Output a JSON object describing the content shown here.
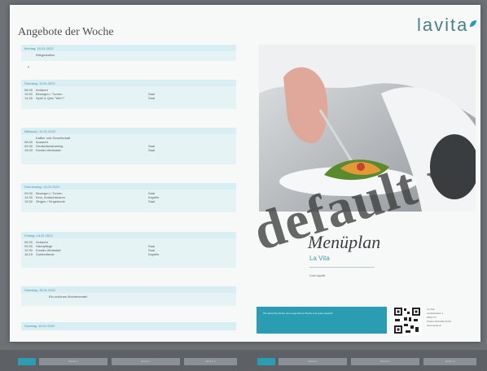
{
  "header": {
    "title": "Angebote der Woche",
    "logo_text": "lavita"
  },
  "days": [
    {
      "head": "Montag, 10.01.2022",
      "rows": [
        {
          "t": "",
          "d": "Wiegestation",
          "r": ""
        }
      ],
      "note": ""
    },
    {
      "head": "Dienstag, 11.01.2022",
      "rows": [
        {
          "t": "08:30",
          "d": "Andacht",
          "r": ""
        },
        {
          "t": "10:00",
          "d": "Bewegen / Turnen",
          "r": "Saal"
        },
        {
          "t": "14:30",
          "d": "Spiel & Quiz \"Wer?\"",
          "r": "Saal"
        }
      ],
      "note": ""
    },
    {
      "head": "Mittwoch, 12.01.2022",
      "rows": [
        {
          "t": "",
          "d": "Kaffee und Gesellschaft",
          "r": ""
        },
        {
          "t": "08:30",
          "d": "Andacht",
          "r": ""
        },
        {
          "t": "09:30",
          "d": "Gedächtnistraining",
          "r": "Saal"
        },
        {
          "t": "15:00",
          "d": "Kreativ-Werkstatt",
          "r": "Saal"
        }
      ],
      "note": ""
    },
    {
      "head": "Donnerstag, 13.01.2022",
      "rows": [
        {
          "t": "09:30",
          "d": "Bewegen / Turnen",
          "r": "Saal"
        },
        {
          "t": "14:30",
          "d": "Kino, Andachtsraum",
          "r": "Kapelle"
        },
        {
          "t": "15:30",
          "d": "Singen / Singstunde",
          "r": "Saal"
        }
      ],
      "note": ""
    },
    {
      "head": "Freitag, 14.01.2022",
      "rows": [
        {
          "t": "08:30",
          "d": "Andacht",
          "r": ""
        },
        {
          "t": "09:30",
          "d": "Handpflege",
          "r": "Saal"
        },
        {
          "t": "10:30",
          "d": "Kreativ-Werkstatt",
          "r": "Saal"
        },
        {
          "t": "16:15",
          "d": "Gottesdienst",
          "r": "Kapelle"
        }
      ],
      "note": ""
    },
    {
      "head": "Samstag, 15.01.2022",
      "rows": [],
      "note": "Ein schönes Wochenende!"
    },
    {
      "head": "Sonntag, 16.01.2022",
      "rows": [],
      "note": ""
    }
  ],
  "menu": {
    "title": "Menüplan",
    "subtitle": "La Vita",
    "small": "Gute Appetit"
  },
  "teal_box": {
    "text": "Wir wünschen Ihnen eine angenehme Woche und guten Appetit!"
  },
  "contact": {
    "lines": [
      "La Vita",
      "Lavitastrasse 1",
      "0000 Ort",
      "Telefon 000 000 00 00",
      "www.lavita.ch"
    ]
  },
  "watermark": "default w",
  "tabs": [
    {
      "label": "",
      "active": true
    },
    {
      "label": "Woche 1",
      "active": false
    },
    {
      "label": "Woche 2",
      "active": false
    },
    {
      "label": "Woche 3",
      "active": false
    },
    {
      "label": "",
      "active": true
    },
    {
      "label": "Woche 1",
      "active": false
    },
    {
      "label": "Woche 2",
      "active": false
    },
    {
      "label": "Woche 3",
      "active": false
    }
  ]
}
